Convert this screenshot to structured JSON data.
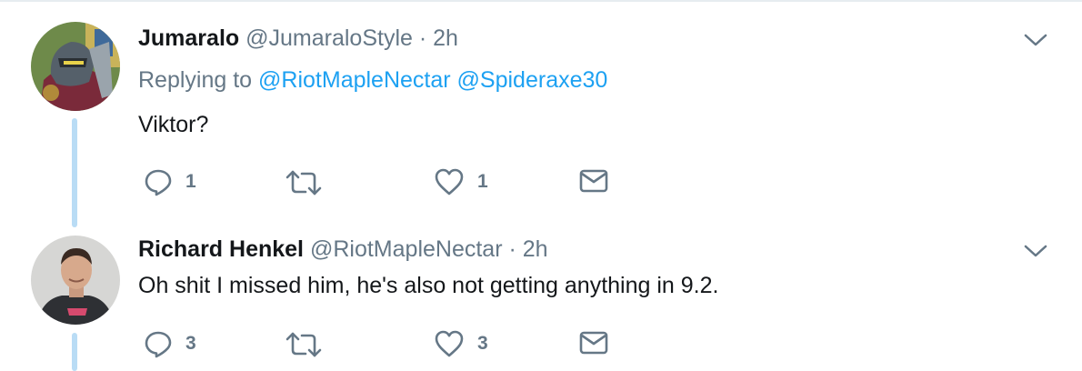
{
  "tweets": [
    {
      "name": "Jumaralo",
      "handle": "@JumaraloStyle",
      "separator": "·",
      "time": "2h",
      "replying_prefix": "Replying to",
      "replying_to": [
        "@RiotMapleNectar",
        "@Spideraxe30"
      ],
      "text": "Viktor?",
      "reply_count": "1",
      "like_count": "1",
      "avatar_icon": "robot-character-avatar"
    },
    {
      "name": "Richard Henkel",
      "handle": "@RiotMapleNectar",
      "separator": "·",
      "time": "2h",
      "text": "Oh shit I missed him, he's also not getting anything in 9.2.",
      "reply_count": "3",
      "like_count": "3",
      "avatar_icon": "person-photo-avatar"
    }
  ],
  "colors": {
    "accent": "#1da1f2",
    "secondary_text": "#657786",
    "thread_line": "#b9dcf5"
  }
}
